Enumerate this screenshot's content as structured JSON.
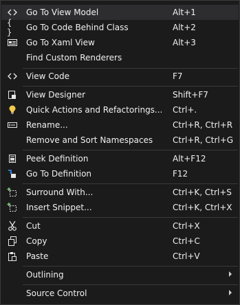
{
  "menu": {
    "items": [
      {
        "label": "Go To View Model",
        "shortcut": "Alt+1",
        "icon": "code-brackets-icon"
      },
      {
        "label": "Go To Code Behind Class",
        "shortcut": "Alt+2",
        "icon": "curly-braces-icon"
      },
      {
        "label": "Go To Xaml View",
        "shortcut": "Alt+3",
        "icon": "xaml-view-icon"
      },
      {
        "label": "Find Custom Renderers",
        "shortcut": "",
        "icon": ""
      },
      {
        "label": "View Code",
        "shortcut": "F7",
        "icon": "code-brackets-icon"
      },
      {
        "label": "View Designer",
        "shortcut": "Shift+F7",
        "icon": "designer-icon"
      },
      {
        "label": "Quick Actions and Refactorings...",
        "shortcut": "Ctrl+.",
        "icon": "lightbulb-icon"
      },
      {
        "label": "Rename...",
        "shortcut": "Ctrl+R, Ctrl+R",
        "icon": "rename-icon"
      },
      {
        "label": "Remove and Sort Namespaces",
        "shortcut": "Ctrl+R, Ctrl+G",
        "icon": ""
      },
      {
        "label": "Peek Definition",
        "shortcut": "Alt+F12",
        "icon": "peek-definition-icon"
      },
      {
        "label": "Go To Definition",
        "shortcut": "F12",
        "icon": "go-to-definition-icon"
      },
      {
        "label": "Surround With...",
        "shortcut": "Ctrl+K, Ctrl+S",
        "icon": "surround-with-icon"
      },
      {
        "label": "Insert Snippet...",
        "shortcut": "Ctrl+K, Ctrl+X",
        "icon": "insert-snippet-icon"
      },
      {
        "label": "Cut",
        "shortcut": "Ctrl+X",
        "icon": "scissors-icon"
      },
      {
        "label": "Copy",
        "shortcut": "Ctrl+C",
        "icon": "copy-icon"
      },
      {
        "label": "Paste",
        "shortcut": "Ctrl+V",
        "icon": "paste-icon"
      },
      {
        "label": "Outlining",
        "shortcut": "",
        "icon": "submenu-arrow-icon"
      },
      {
        "label": "Source Control",
        "shortcut": "",
        "icon": "submenu-arrow-icon"
      }
    ]
  },
  "colors": {
    "background": "#1b1b1c",
    "highlight": "#2d2d30",
    "text": "#f1f1f1",
    "accent_green": "#89d185",
    "accent_yellow": "#f2c94c",
    "accent_blue": "#3794ff"
  }
}
